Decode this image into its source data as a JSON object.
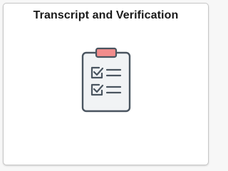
{
  "tile": {
    "title": "Transcript and Verification",
    "icon": "clipboard-checklist-icon"
  },
  "colors": {
    "background": "#f7f7f7",
    "tile_background": "#ffffff",
    "tile_border": "#c8c8c8",
    "title_text": "#1a1a1a",
    "icon_stroke": "#4a5560",
    "icon_fill": "#f1f3f5",
    "clip_accent": "#f28c8c"
  }
}
